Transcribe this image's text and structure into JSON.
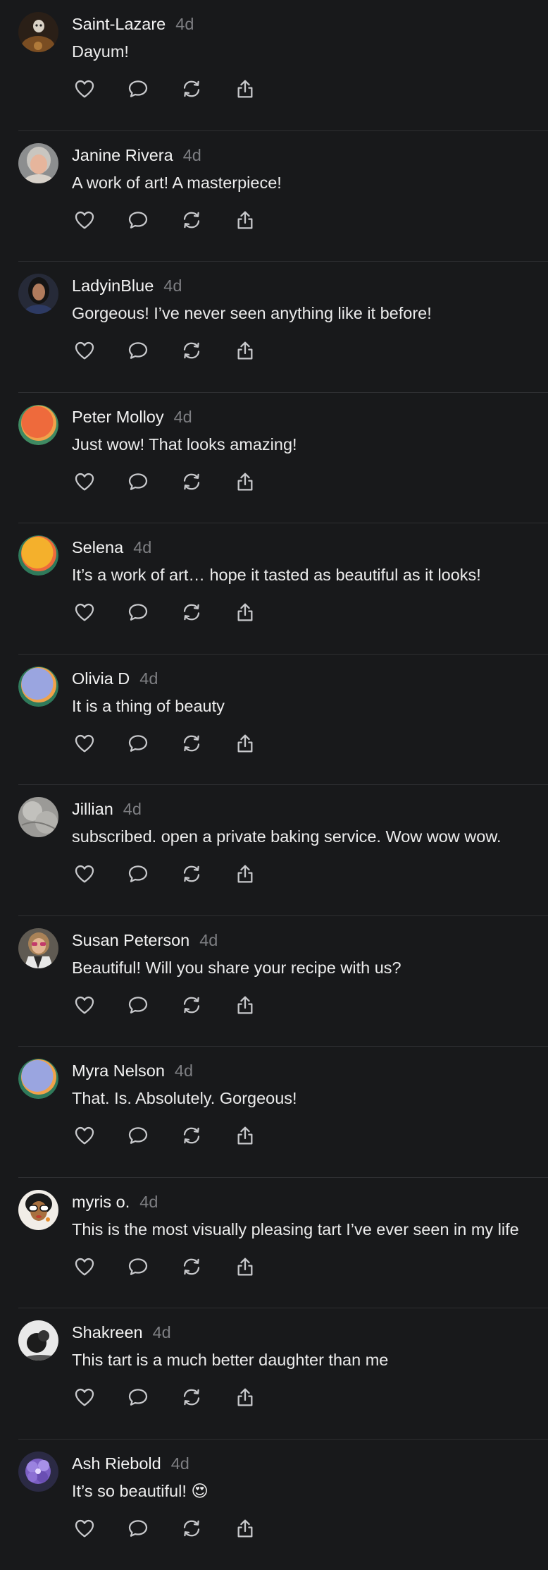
{
  "colors": {
    "background": "#18191b",
    "divider": "#2e2f32",
    "username": "#f3f3f3",
    "timestamp": "#7d7e82",
    "icon": "#c8c9cc"
  },
  "actions": [
    "heart-icon",
    "comment-icon",
    "repost-icon",
    "share-icon"
  ],
  "comments": [
    {
      "username": "Saint-Lazare",
      "time": "4d",
      "text": "Dayum!",
      "avatar": "photo-dark-portrait"
    },
    {
      "username": "Janine Rivera",
      "time": "4d",
      "text": "A work of art! A masterpiece!",
      "avatar": "photo-woman-grey-hair"
    },
    {
      "username": "LadyinBlue",
      "time": "4d",
      "text": "Gorgeous! I’ve never seen anything like it before!",
      "avatar": "photo-woman-dark-hair"
    },
    {
      "username": "Peter Molloy",
      "time": "4d",
      "text": "Just wow! That looks amazing!",
      "avatar": "default-orange"
    },
    {
      "username": "Selena",
      "time": "4d",
      "text": "It’s a work of art… hope it tasted as beautiful as it looks!",
      "avatar": "default-yellow"
    },
    {
      "username": "Olivia D",
      "time": "4d",
      "text": "It is a thing of beauty",
      "avatar": "default-lavender"
    },
    {
      "username": "Jillian",
      "time": "4d",
      "text": "subscribed. open a private baking service. Wow wow wow.",
      "avatar": "photo-grey-texture"
    },
    {
      "username": "Susan Peterson",
      "time": "4d",
      "text": "Beautiful! Will you share your recipe with us?",
      "avatar": "photo-woman-sunglasses"
    },
    {
      "username": "Myra Nelson",
      "time": "4d",
      "text": "That. Is. Absolutely. Gorgeous!",
      "avatar": "default-lavender"
    },
    {
      "username": "myris o.",
      "time": "4d",
      "text": "This is the most visually pleasing tart I’ve ever seen in my life",
      "avatar": "illustration-woman-glasses"
    },
    {
      "username": "Shakreen",
      "time": "4d",
      "text": "This tart is a much better daughter than me",
      "avatar": "photo-bw-silhouette"
    },
    {
      "username": "Ash Riebold",
      "time": "4d",
      "text": "It’s so beautiful! 😍",
      "avatar": "photo-purple-flower"
    }
  ]
}
